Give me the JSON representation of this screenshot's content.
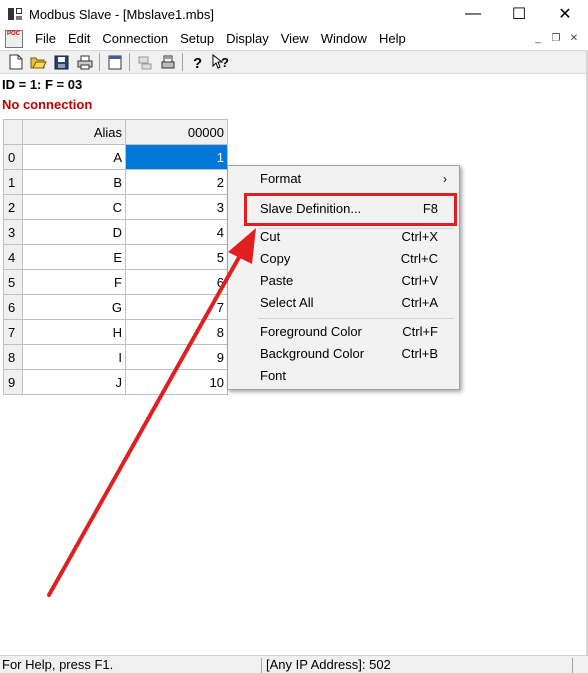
{
  "window": {
    "title": "Modbus Slave - [Mbslave1.mbs]",
    "minimize_glyph": "—",
    "maximize_glyph": "☐",
    "close_glyph": "✕"
  },
  "menu": {
    "app_icon_text": "POC",
    "items": [
      "File",
      "Edit",
      "Connection",
      "Setup",
      "Display",
      "View",
      "Window",
      "Help"
    ],
    "mdi_minimize": "_",
    "mdi_restore": "❐",
    "mdi_close": "✕"
  },
  "toolbar": {
    "icons": [
      "new-icon",
      "open-icon",
      "save-icon",
      "print-icon",
      "window-icon",
      "connect-icon",
      "print2-icon",
      "help-icon",
      "context-help-icon"
    ]
  },
  "info": {
    "id_line": "ID = 1: F = 03",
    "connection": "No connection"
  },
  "grid": {
    "alias_header": "Alias",
    "value_header": "00000",
    "rows": [
      {
        "index": "0",
        "alias": "A",
        "value": "1"
      },
      {
        "index": "1",
        "alias": "B",
        "value": "2"
      },
      {
        "index": "2",
        "alias": "C",
        "value": "3"
      },
      {
        "index": "3",
        "alias": "D",
        "value": "4"
      },
      {
        "index": "4",
        "alias": "E",
        "value": "5"
      },
      {
        "index": "5",
        "alias": "F",
        "value": "6"
      },
      {
        "index": "6",
        "alias": "G",
        "value": "7"
      },
      {
        "index": "7",
        "alias": "H",
        "value": "8"
      },
      {
        "index": "8",
        "alias": "I",
        "value": "9"
      },
      {
        "index": "9",
        "alias": "J",
        "value": "10"
      }
    ]
  },
  "context_menu": {
    "format": {
      "label": "Format",
      "arrow": "›"
    },
    "slave_definition": {
      "label": "Slave Definition...",
      "shortcut": "F8"
    },
    "cut": {
      "label": "Cut",
      "shortcut": "Ctrl+X"
    },
    "copy": {
      "label": "Copy",
      "shortcut": "Ctrl+C"
    },
    "paste": {
      "label": "Paste",
      "shortcut": "Ctrl+V"
    },
    "select_all": {
      "label": "Select All",
      "shortcut": "Ctrl+A"
    },
    "foreground": {
      "label": "Foreground Color",
      "shortcut": "Ctrl+F"
    },
    "background": {
      "label": "Background Color",
      "shortcut": "Ctrl+B"
    },
    "font": {
      "label": "Font",
      "shortcut": ""
    }
  },
  "status": {
    "help": "For Help, press F1.",
    "address": "[Any IP Address]: 502"
  },
  "colors": {
    "selection": "#0078d7",
    "error_text": "#c00000",
    "annotation": "#e02020"
  }
}
